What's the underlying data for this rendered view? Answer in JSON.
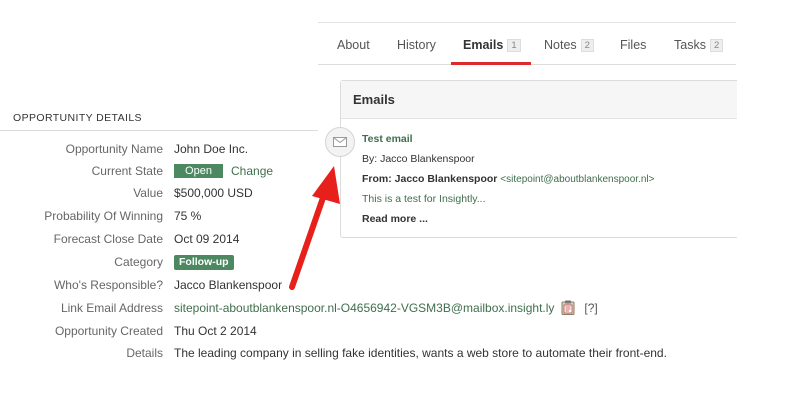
{
  "tabs": [
    {
      "label": "About",
      "count": ""
    },
    {
      "label": "History",
      "count": ""
    },
    {
      "label": "Emails",
      "count": "1"
    },
    {
      "label": "Notes",
      "count": "2"
    },
    {
      "label": "Files",
      "count": ""
    },
    {
      "label": "Tasks",
      "count": "2"
    }
  ],
  "active_tab": "Emails",
  "emails_panel": {
    "header": "Emails",
    "email": {
      "subject": "Test email",
      "by": "By: Jacco Blankenspoor",
      "from_label": "From: Jacco Blankenspoor",
      "from_address": "<sitepoint@aboutblankenspoor.nl>",
      "snippet": "This is a test for Insightly...",
      "read_more": "Read more ..."
    }
  },
  "details": {
    "title": "OPPORTUNITY DETAILS",
    "rows": [
      {
        "label": "Opportunity Name",
        "value": "John Doe Inc."
      },
      {
        "label": "Current State",
        "value": "Open",
        "action": "Change"
      },
      {
        "label": "Value",
        "value": "$500,000 USD"
      },
      {
        "label": "Probability Of Winning",
        "value": "75 %"
      },
      {
        "label": "Forecast Close Date",
        "value": "Oct 09 2014"
      },
      {
        "label": "Category",
        "value": "Follow-up"
      },
      {
        "label": "Who's Responsible?",
        "value": "Jacco Blankenspoor"
      },
      {
        "label": "Link Email Address",
        "value": "sitepoint-aboutblankenspoor.nl-O4656942-VGSM3B@mailbox.insight.ly",
        "action": "[?]"
      },
      {
        "label": "Opportunity Created",
        "value": "Thu Oct 2 2014"
      },
      {
        "label": "Details",
        "value": "The leading company in selling fake identities, wants a web store to automate their front-end."
      }
    ]
  },
  "colors": {
    "accent_red": "#dd2b2b",
    "badge_green": "#4d8960",
    "link_green": "#3f6e4c"
  },
  "icons": [
    "envelope-icon",
    "clipboard-icon",
    "annotation-arrow"
  ]
}
